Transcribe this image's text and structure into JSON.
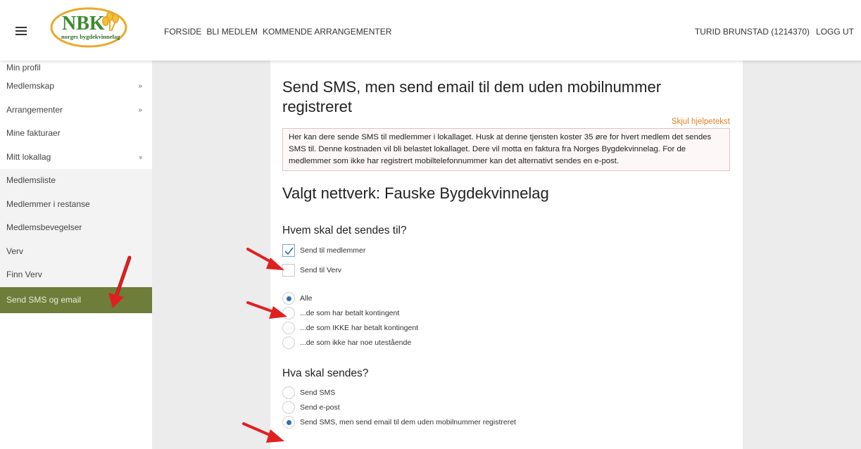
{
  "header": {
    "logo": {
      "main": "NBK",
      "sub": "norges bygdekvinnelag"
    },
    "nav": [
      "FORSIDE",
      "BLI MEDLEM",
      "KOMMENDE ARRANGEMENTER"
    ],
    "user_name": "TURID BRUNSTAD (1214370)",
    "logout": "LOGG UT"
  },
  "sidebar": {
    "items": [
      {
        "label": "Min profil",
        "chevron": ""
      },
      {
        "label": "Medlemskap",
        "chevron": "»"
      },
      {
        "label": "Arrangementer",
        "chevron": "»"
      },
      {
        "label": "Mine fakturaer",
        "chevron": ""
      },
      {
        "label": "Mitt lokallag",
        "chevron": "»"
      }
    ],
    "sub_items": [
      {
        "label": "Medlemsliste"
      },
      {
        "label": "Medlemmer i restanse"
      },
      {
        "label": "Medlemsbevegelser"
      },
      {
        "label": "Verv"
      },
      {
        "label": "Finn Verv"
      },
      {
        "label": "Send SMS og email"
      }
    ]
  },
  "main": {
    "title": "Send SMS, men send email til dem uden mobilnummer registreret",
    "help_toggle": "Skjul hjelpetekst",
    "help_text": "Her kan dere sende SMS til medlemmer i lokallaget. Husk at denne tjensten koster 35 øre for hvert medlem det sendes SMS til. Denne kostnaden vil bli belastet lokallaget. Dere vil motta en faktura fra Norges Bygdekvinnelag. For de medlemmer som ikke har registrert mobiltelefonnummer kan det alternativt sendes en e-post.",
    "network": "Valgt nettverk: Fauske Bygdekvinnelag",
    "recipients_heading": "Hvem skal det sendes til?",
    "recipient_checks": [
      {
        "label": "Send til medlemmer",
        "checked": true
      },
      {
        "label": "Send til Verv",
        "checked": false
      }
    ],
    "filter_radios": [
      {
        "label": "Alle",
        "selected": true
      },
      {
        "label": "...de som har betalt kontingent",
        "selected": false
      },
      {
        "label": "...de som IKKE har betalt kontingent",
        "selected": false
      },
      {
        "label": "...de som ikke har noe utestående",
        "selected": false
      }
    ],
    "send_heading": "Hva skal sendes?",
    "send_radios": [
      {
        "label": "Send SMS",
        "selected": false
      },
      {
        "label": "Send e-post",
        "selected": false
      },
      {
        "label": "Send SMS, men send email til dem uden mobilnummer registreret",
        "selected": true
      }
    ]
  },
  "colors": {
    "active_sidebar": "#6e7d3a",
    "help_link": "#e67e22",
    "radio_selected": "#2c6fb5",
    "annotation_arrow": "#e02020"
  }
}
